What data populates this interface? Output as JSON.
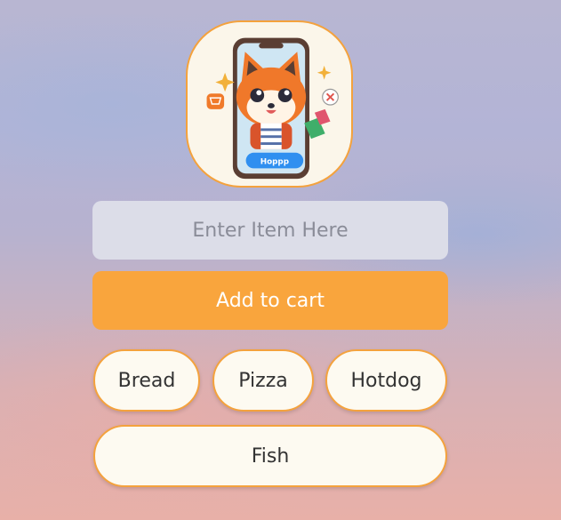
{
  "logo": {
    "phone_button_text": "Hoppp",
    "accent_color": "#f4a23d"
  },
  "input": {
    "placeholder": "Enter Item Here",
    "value": ""
  },
  "add_button": {
    "label": "Add to cart",
    "color": "#f9a53d"
  },
  "items": [
    {
      "label": "Bread"
    },
    {
      "label": "Pizza"
    },
    {
      "label": "Hotdog"
    },
    {
      "label": "Fish"
    }
  ]
}
